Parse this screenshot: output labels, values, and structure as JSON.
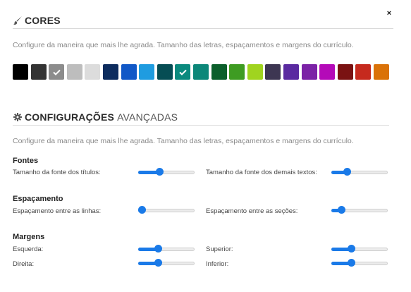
{
  "close": {
    "label": "×"
  },
  "cores": {
    "title": "CORES",
    "icon": "paintbrush-icon",
    "description": "Configure da maneira que mais lhe agrada. Tamanho das letras, espaçamentos e margens do currículo.",
    "swatches": [
      {
        "color": "#000000",
        "selected": false
      },
      {
        "color": "#333333",
        "selected": false
      },
      {
        "color": "#8c8c8c",
        "selected": true
      },
      {
        "color": "#bdbdbd",
        "selected": false
      },
      {
        "color": "#dcdcdc",
        "selected": false
      },
      {
        "color": "#0d2c5e",
        "selected": false
      },
      {
        "color": "#1158c7",
        "selected": false
      },
      {
        "color": "#1f9ce0",
        "selected": false
      },
      {
        "color": "#064d54",
        "selected": false
      },
      {
        "color": "#0a8a7e",
        "selected": true
      },
      {
        "color": "#0c8779",
        "selected": false
      },
      {
        "color": "#0b5f2b",
        "selected": false
      },
      {
        "color": "#3e9c22",
        "selected": false
      },
      {
        "color": "#a0d41f",
        "selected": false
      },
      {
        "color": "#3d3652",
        "selected": false
      },
      {
        "color": "#5a2aa0",
        "selected": false
      },
      {
        "color": "#7b22a6",
        "selected": false
      },
      {
        "color": "#b40ab8",
        "selected": false
      },
      {
        "color": "#7a1212",
        "selected": false
      },
      {
        "color": "#c62a1e",
        "selected": false
      },
      {
        "color": "#da7208",
        "selected": false
      }
    ]
  },
  "config": {
    "title_bold": "CONFIGURAÇÕES",
    "title_normal": "AVANÇADAS",
    "icon": "gear-icon",
    "description": "Configure da maneira que mais lhe agrada. Tamanho das letras, espaçamentos e margens do currículo.",
    "groups": [
      {
        "title": "Fontes",
        "items": [
          {
            "label": "Tamanho da fonte dos títulos:",
            "value": 0.37
          },
          {
            "label": "Tamanho da fonte dos demais textos:",
            "value": 0.27
          }
        ]
      },
      {
        "title": "Espaçamento",
        "items": [
          {
            "label": "Espaçamento entre as linhas:",
            "value": 0.05
          },
          {
            "label": "Espaçamento entre as seções:",
            "value": 0.17
          }
        ]
      },
      {
        "title": "Margens",
        "items": [
          {
            "label": "Esquerda:",
            "value": 0.35
          },
          {
            "label": "Superior:",
            "value": 0.35
          },
          {
            "label": "Direita:",
            "value": 0.35
          },
          {
            "label": "Inferior:",
            "value": 0.35
          }
        ]
      }
    ]
  },
  "colors": {
    "accent": "#1a7ae8"
  }
}
